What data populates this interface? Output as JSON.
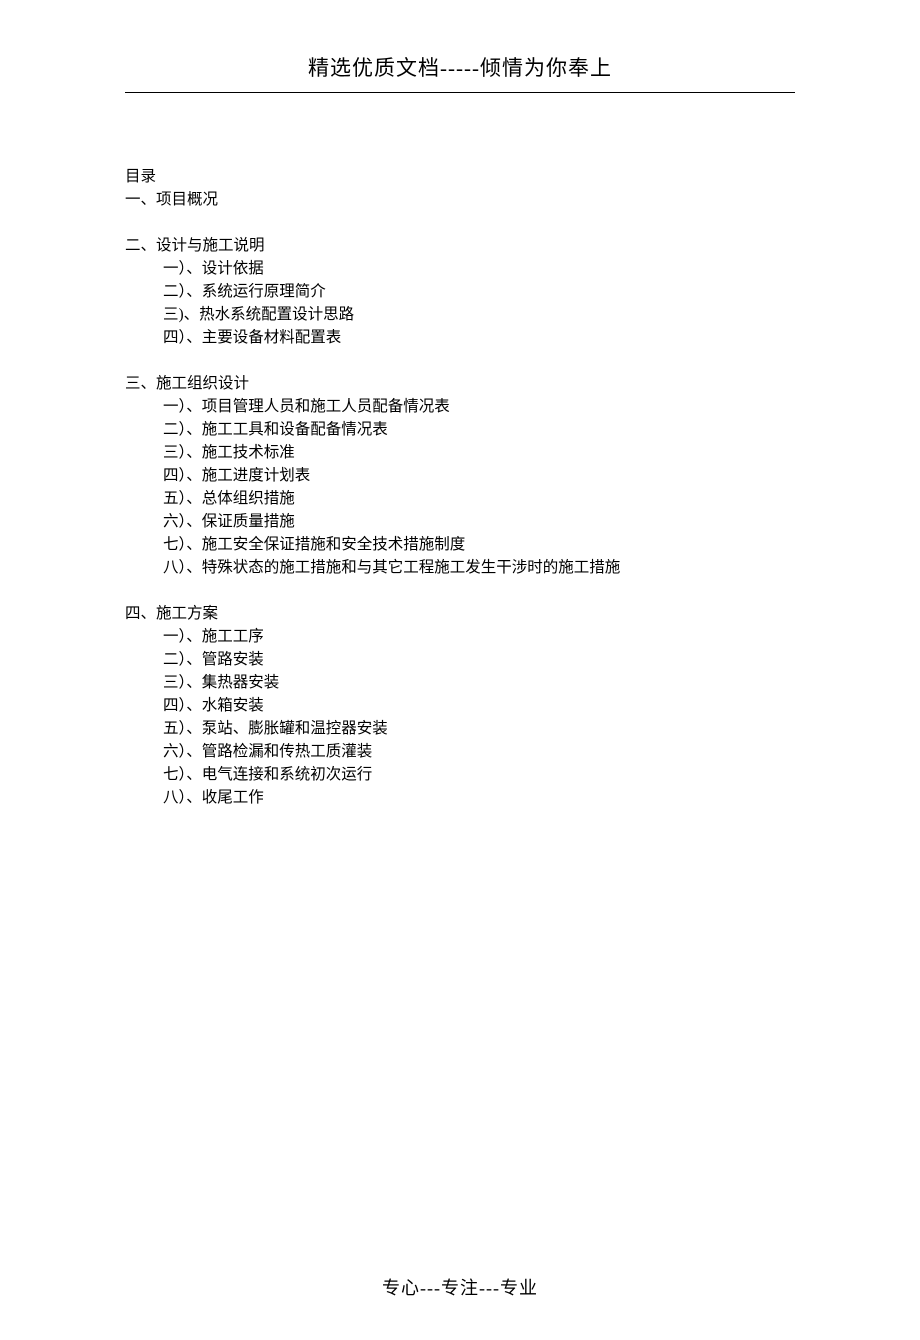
{
  "header": {
    "text": "精选优质文档-----倾情为你奉上"
  },
  "footer": {
    "text": "专心---专注---专业"
  },
  "toc": {
    "title": "目录",
    "sections": [
      {
        "heading": "一、项目概况",
        "items": []
      },
      {
        "heading": "二、设计与施工说明",
        "items": [
          "一）、设计依据",
          "二）、系统运行原理简介",
          "三)、热水系统配置设计思路",
          "四）、主要设备材料配置表"
        ]
      },
      {
        "heading": "三、施工组织设计",
        "items": [
          "一）、项目管理人员和施工人员配备情况表",
          "二）、施工工具和设备配备情况表",
          "三）、施工技术标准",
          "四）、施工进度计划表",
          "五）、总体组织措施",
          "六）、保证质量措施",
          "七）、施工安全保证措施和安全技术措施制度",
          "八）、特殊状态的施工措施和与其它工程施工发生干涉时的施工措施"
        ]
      },
      {
        "heading": "四、施工方案",
        "items": [
          "一）、施工工序",
          "二）、管路安装",
          "三）、集热器安装",
          "四）、水箱安装",
          "五）、泵站、膨胀罐和温控器安装",
          "六）、管路检漏和传热工质灌装",
          "七）、电气连接和系统初次运行",
          "八）、收尾工作"
        ]
      }
    ]
  }
}
